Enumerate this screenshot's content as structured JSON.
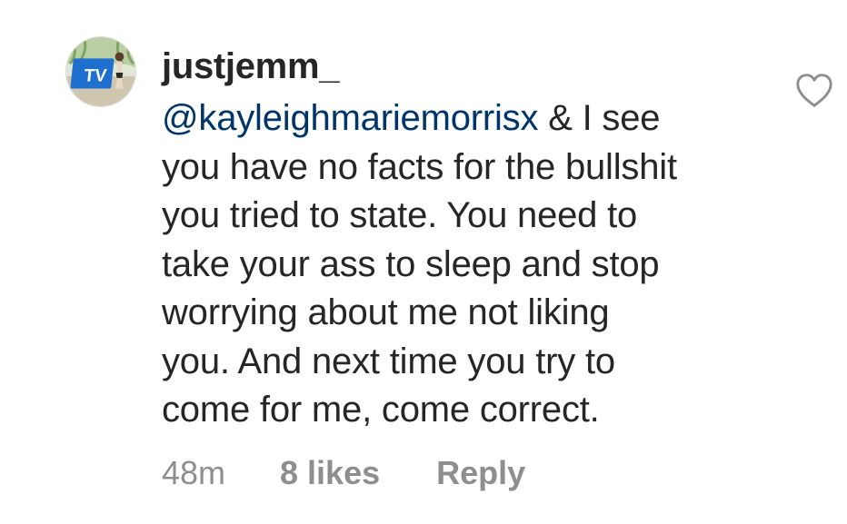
{
  "comment": {
    "username": "justjemm_",
    "mention": "@kayleighmariemorrisx",
    "lines": [
      " & I see",
      "you have no facts for the bullshit",
      "you tried to state. You need to",
      "take your ass to sleep and stop",
      "worrying about me not liking",
      "you. And next time you try to",
      "come for me, come correct."
    ],
    "time": "48m",
    "likes": "8 likes",
    "reply_label": "Reply"
  },
  "avatar": {
    "logo_text": "TV",
    "logo_color": "#1f6fd1"
  },
  "icons": {
    "like": "heart-outline-icon"
  },
  "colors": {
    "text": "#262626",
    "mention": "#003569",
    "meta": "#8e8e8e"
  }
}
